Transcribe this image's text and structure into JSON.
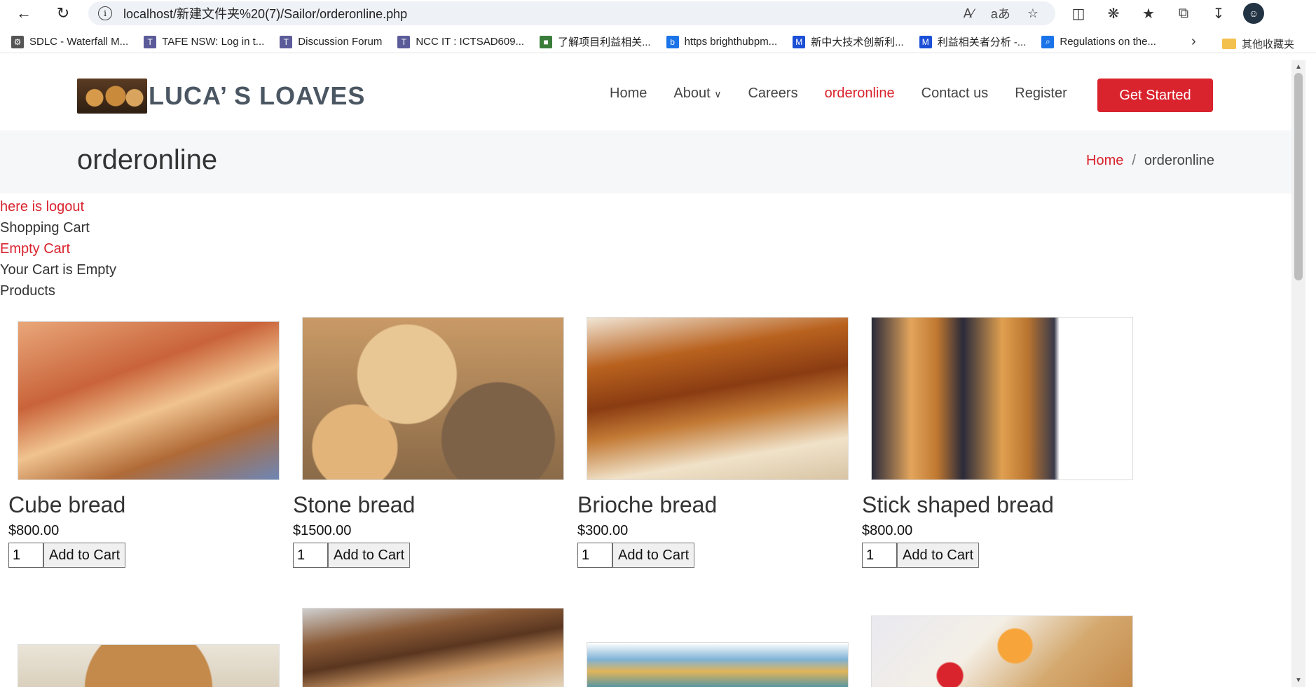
{
  "browser": {
    "url": "localhost/新建文件夹%20(7)/Sailor/orderonline.php",
    "back_icon": "arrow-left-icon",
    "refresh_icon": "refresh-icon",
    "read_aloud": "A‍⁾",
    "translate": "aあ",
    "bookmarks": [
      {
        "label": "SDLC - Waterfall M...",
        "icon": "gear-icon",
        "color": "#555555"
      },
      {
        "label": "TAFE NSW: Log in t...",
        "icon": "T-icon",
        "color": "#5b5b9a"
      },
      {
        "label": "Discussion Forum",
        "icon": "T-icon",
        "color": "#5b5b9a"
      },
      {
        "label": "NCC IT : ICTSAD609...",
        "icon": "T-icon",
        "color": "#5b5b9a"
      },
      {
        "label": "了解项目利益相关...",
        "icon": "pmi-icon",
        "color": "#3a7d3a"
      },
      {
        "label": "https brighthubpm...",
        "icon": "bing-icon",
        "color": "#1a73e8"
      },
      {
        "label": "新中大技术创新利...",
        "icon": "M-icon",
        "color": "#1a4fd6"
      },
      {
        "label": "利益相关者分析 -...",
        "icon": "M-icon",
        "color": "#1a4fd6"
      },
      {
        "label": "Regulations on the...",
        "icon": "search-icon",
        "color": "#1a73e8"
      }
    ],
    "other_bookmarks": "其他收藏夹"
  },
  "site": {
    "logo": "LUCA’  S LOAVES",
    "nav": [
      {
        "label": "Home",
        "active": false
      },
      {
        "label": "About",
        "active": false,
        "dropdown": true
      },
      {
        "label": "Careers",
        "active": false
      },
      {
        "label": "orderonline",
        "active": true
      },
      {
        "label": "Contact us",
        "active": false
      },
      {
        "label": "Register",
        "active": false
      }
    ],
    "cta": "Get Started",
    "accent": "#d9232d"
  },
  "page": {
    "title": "orderonline",
    "breadcrumb_home": "Home",
    "breadcrumb_sep": "/",
    "breadcrumb_current": "orderonline"
  },
  "cart": {
    "logout_link": "here is logout",
    "heading": "Shopping Cart",
    "empty_link": "Empty Cart",
    "status": "Your Cart is Empty",
    "products_heading": "Products"
  },
  "products": [
    {
      "name": "Cube bread",
      "price": "$800.00",
      "qty": "1",
      "button": "Add to Cart"
    },
    {
      "name": "Stone bread",
      "price": "$1500.00",
      "qty": "1",
      "button": "Add to Cart"
    },
    {
      "name": "Brioche bread",
      "price": "$300.00",
      "qty": "1",
      "button": "Add to Cart"
    },
    {
      "name": "Stick shaped bread",
      "price": "$800.00",
      "qty": "1",
      "button": "Add to Cart"
    }
  ]
}
